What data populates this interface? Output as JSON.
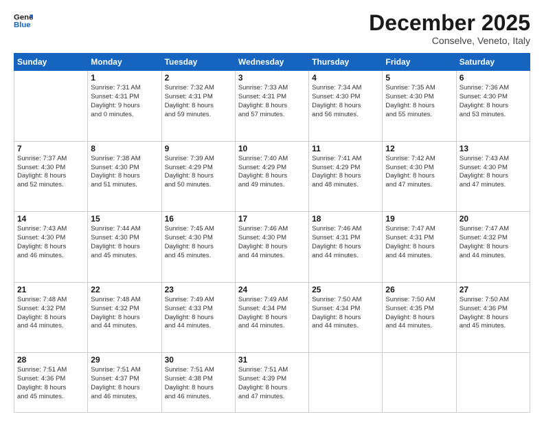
{
  "logo": {
    "line1": "General",
    "line2": "Blue"
  },
  "header": {
    "month": "December 2025",
    "location": "Conselve, Veneto, Italy"
  },
  "weekdays": [
    "Sunday",
    "Monday",
    "Tuesday",
    "Wednesday",
    "Thursday",
    "Friday",
    "Saturday"
  ],
  "weeks": [
    [
      {
        "day": "",
        "info": ""
      },
      {
        "day": "1",
        "info": "Sunrise: 7:31 AM\nSunset: 4:31 PM\nDaylight: 9 hours\nand 0 minutes."
      },
      {
        "day": "2",
        "info": "Sunrise: 7:32 AM\nSunset: 4:31 PM\nDaylight: 8 hours\nand 59 minutes."
      },
      {
        "day": "3",
        "info": "Sunrise: 7:33 AM\nSunset: 4:31 PM\nDaylight: 8 hours\nand 57 minutes."
      },
      {
        "day": "4",
        "info": "Sunrise: 7:34 AM\nSunset: 4:30 PM\nDaylight: 8 hours\nand 56 minutes."
      },
      {
        "day": "5",
        "info": "Sunrise: 7:35 AM\nSunset: 4:30 PM\nDaylight: 8 hours\nand 55 minutes."
      },
      {
        "day": "6",
        "info": "Sunrise: 7:36 AM\nSunset: 4:30 PM\nDaylight: 8 hours\nand 53 minutes."
      }
    ],
    [
      {
        "day": "7",
        "info": "Sunrise: 7:37 AM\nSunset: 4:30 PM\nDaylight: 8 hours\nand 52 minutes."
      },
      {
        "day": "8",
        "info": "Sunrise: 7:38 AM\nSunset: 4:30 PM\nDaylight: 8 hours\nand 51 minutes."
      },
      {
        "day": "9",
        "info": "Sunrise: 7:39 AM\nSunset: 4:29 PM\nDaylight: 8 hours\nand 50 minutes."
      },
      {
        "day": "10",
        "info": "Sunrise: 7:40 AM\nSunset: 4:29 PM\nDaylight: 8 hours\nand 49 minutes."
      },
      {
        "day": "11",
        "info": "Sunrise: 7:41 AM\nSunset: 4:29 PM\nDaylight: 8 hours\nand 48 minutes."
      },
      {
        "day": "12",
        "info": "Sunrise: 7:42 AM\nSunset: 4:30 PM\nDaylight: 8 hours\nand 47 minutes."
      },
      {
        "day": "13",
        "info": "Sunrise: 7:43 AM\nSunset: 4:30 PM\nDaylight: 8 hours\nand 47 minutes."
      }
    ],
    [
      {
        "day": "14",
        "info": "Sunrise: 7:43 AM\nSunset: 4:30 PM\nDaylight: 8 hours\nand 46 minutes."
      },
      {
        "day": "15",
        "info": "Sunrise: 7:44 AM\nSunset: 4:30 PM\nDaylight: 8 hours\nand 45 minutes."
      },
      {
        "day": "16",
        "info": "Sunrise: 7:45 AM\nSunset: 4:30 PM\nDaylight: 8 hours\nand 45 minutes."
      },
      {
        "day": "17",
        "info": "Sunrise: 7:46 AM\nSunset: 4:30 PM\nDaylight: 8 hours\nand 44 minutes."
      },
      {
        "day": "18",
        "info": "Sunrise: 7:46 AM\nSunset: 4:31 PM\nDaylight: 8 hours\nand 44 minutes."
      },
      {
        "day": "19",
        "info": "Sunrise: 7:47 AM\nSunset: 4:31 PM\nDaylight: 8 hours\nand 44 minutes."
      },
      {
        "day": "20",
        "info": "Sunrise: 7:47 AM\nSunset: 4:32 PM\nDaylight: 8 hours\nand 44 minutes."
      }
    ],
    [
      {
        "day": "21",
        "info": "Sunrise: 7:48 AM\nSunset: 4:32 PM\nDaylight: 8 hours\nand 44 minutes."
      },
      {
        "day": "22",
        "info": "Sunrise: 7:48 AM\nSunset: 4:32 PM\nDaylight: 8 hours\nand 44 minutes."
      },
      {
        "day": "23",
        "info": "Sunrise: 7:49 AM\nSunset: 4:33 PM\nDaylight: 8 hours\nand 44 minutes."
      },
      {
        "day": "24",
        "info": "Sunrise: 7:49 AM\nSunset: 4:34 PM\nDaylight: 8 hours\nand 44 minutes."
      },
      {
        "day": "25",
        "info": "Sunrise: 7:50 AM\nSunset: 4:34 PM\nDaylight: 8 hours\nand 44 minutes."
      },
      {
        "day": "26",
        "info": "Sunrise: 7:50 AM\nSunset: 4:35 PM\nDaylight: 8 hours\nand 44 minutes."
      },
      {
        "day": "27",
        "info": "Sunrise: 7:50 AM\nSunset: 4:36 PM\nDaylight: 8 hours\nand 45 minutes."
      }
    ],
    [
      {
        "day": "28",
        "info": "Sunrise: 7:51 AM\nSunset: 4:36 PM\nDaylight: 8 hours\nand 45 minutes."
      },
      {
        "day": "29",
        "info": "Sunrise: 7:51 AM\nSunset: 4:37 PM\nDaylight: 8 hours\nand 46 minutes."
      },
      {
        "day": "30",
        "info": "Sunrise: 7:51 AM\nSunset: 4:38 PM\nDaylight: 8 hours\nand 46 minutes."
      },
      {
        "day": "31",
        "info": "Sunrise: 7:51 AM\nSunset: 4:39 PM\nDaylight: 8 hours\nand 47 minutes."
      },
      {
        "day": "",
        "info": ""
      },
      {
        "day": "",
        "info": ""
      },
      {
        "day": "",
        "info": ""
      }
    ]
  ]
}
